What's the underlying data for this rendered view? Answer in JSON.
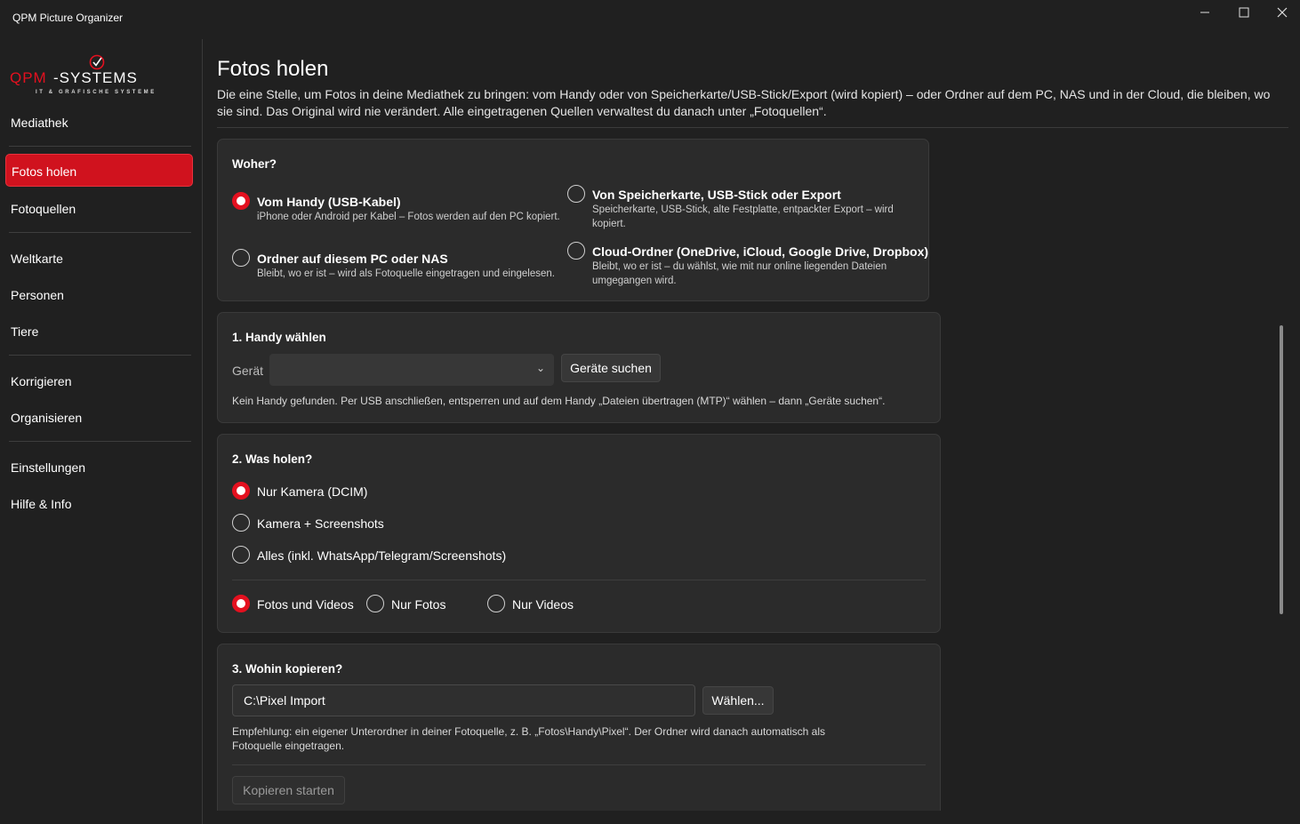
{
  "window": {
    "title": "QPM Picture Organizer"
  },
  "logo": {
    "text": "QPM-SYSTEMS",
    "tagline": "IT & GRAFISCHE SYSTEME"
  },
  "sidebar": {
    "items": [
      {
        "label": "Mediathek"
      },
      {
        "label": "Fotos holen"
      },
      {
        "label": "Fotoquellen"
      },
      {
        "label": "Weltkarte"
      },
      {
        "label": "Personen"
      },
      {
        "label": "Tiere"
      },
      {
        "label": "Korrigieren"
      },
      {
        "label": "Organisieren"
      },
      {
        "label": "Einstellungen"
      },
      {
        "label": "Hilfe & Info"
      }
    ],
    "active": "Fotos holen"
  },
  "main": {
    "title": "Fotos holen",
    "description": "Die eine Stelle, um Fotos in deine Mediathek zu bringen: vom Handy oder von Speicherkarte/USB-Stick/Export (wird kopiert) – oder Ordner auf dem PC, NAS und in der Cloud, die bleiben, wo sie sind. Das Original wird nie verändert. Alle eingetragenen Quellen verwaltest du danach unter „Fotoquellen“."
  },
  "source": {
    "title": "Woher?",
    "options": [
      {
        "label": "Vom Handy (USB-Kabel)",
        "sub": "iPhone oder Android per Kabel – Fotos werden auf den PC kopiert.",
        "selected": true
      },
      {
        "label": "Von Speicherkarte, USB-Stick oder Export",
        "sub": "Speicherkarte, USB-Stick, alte Festplatte, entpackter Export – wird kopiert.",
        "selected": false
      },
      {
        "label": "Ordner auf diesem PC oder NAS",
        "sub": "Bleibt, wo er ist – wird als Fotoquelle eingetragen und eingelesen.",
        "selected": false
      },
      {
        "label": "Cloud-Ordner (OneDrive, iCloud, Google Drive, Dropbox)",
        "sub": "Bleibt, wo er ist – du wählst, wie mit nur online liegenden Dateien umgegangen wird.",
        "selected": false
      }
    ]
  },
  "step1": {
    "title": "1. Handy wählen",
    "device_label": "Gerät",
    "device_value": "",
    "search_button": "Geräte suchen",
    "status": "Kein Handy gefunden. Per USB anschließen, entsperren und auf dem Handy „Dateien übertragen (MTP)“ wählen – dann „Geräte suchen“."
  },
  "step2": {
    "title": "2. Was holen?",
    "scope_options": [
      {
        "label": "Nur Kamera (DCIM)",
        "selected": true
      },
      {
        "label": "Kamera + Screenshots",
        "selected": false
      },
      {
        "label": "Alles (inkl. WhatsApp/Telegram/Screenshots)",
        "selected": false
      }
    ],
    "media_options": [
      {
        "label": "Fotos und Videos",
        "selected": true
      },
      {
        "label": "Nur Fotos",
        "selected": false
      },
      {
        "label": "Nur Videos",
        "selected": false
      }
    ]
  },
  "step3": {
    "title": "3. Wohin kopieren?",
    "path_value": "C:\\Pixel Import",
    "choose_button": "Wählen...",
    "hint": "Empfehlung: ein eigener Unterordner in deiner Fotoquelle, z. B. „Fotos\\Handy\\Pixel“. Der Ordner wird danach automatisch als Fotoquelle eingetragen.",
    "start_button": "Kopieren starten"
  },
  "colors": {
    "accent": "#e4101f",
    "active_nav": "#d0121e",
    "background": "#202020",
    "card": "#2b2b2b"
  }
}
